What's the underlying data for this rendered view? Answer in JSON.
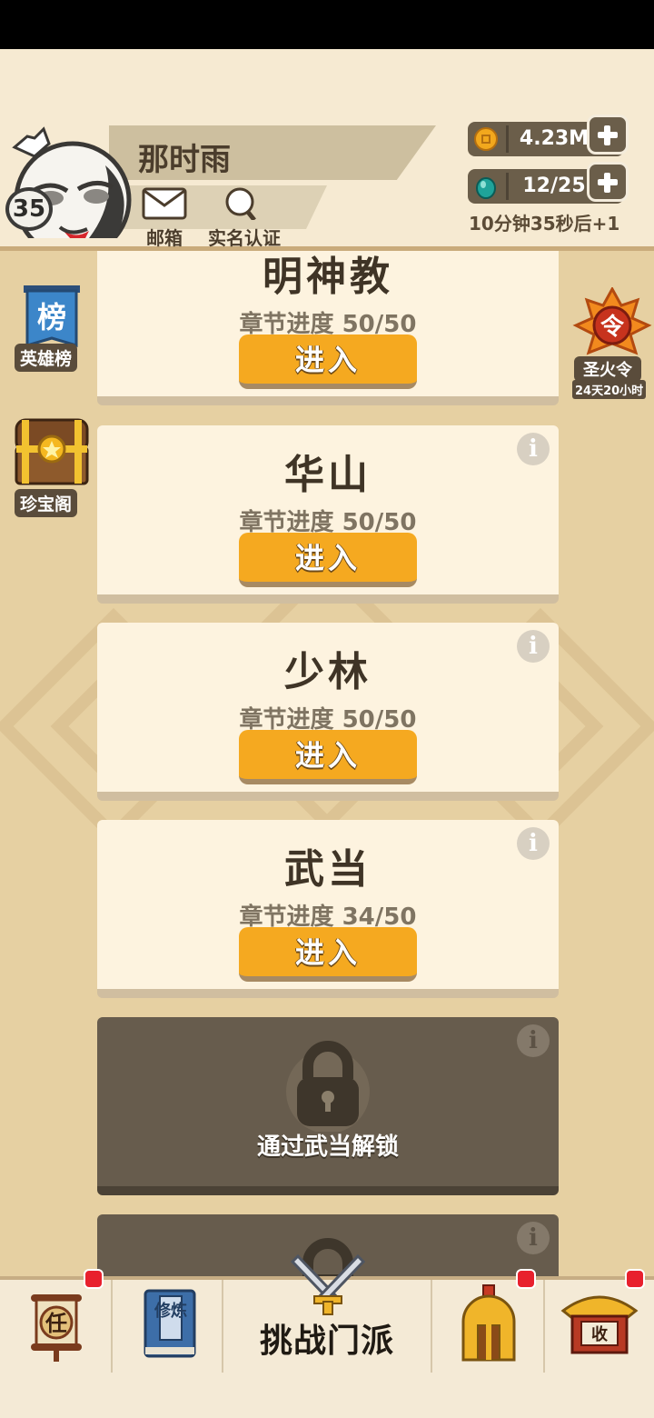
{
  "player": {
    "name": "那时雨",
    "level": "35",
    "mail_label": "邮箱",
    "verify_label": "实名认证"
  },
  "resources": {
    "coins": "4.23M",
    "energy": "12/25",
    "energy_timer": "10分钟35秒后+1"
  },
  "side": {
    "hero_rank": {
      "glyph": "榜",
      "label": "英雄榜"
    },
    "treasure": {
      "label": "珍宝阁"
    },
    "holy_fire": {
      "glyph": "令",
      "label": "圣火令",
      "time": "24天20小时"
    }
  },
  "sects": [
    {
      "title": "明神教",
      "progress": "章节进度 50/50",
      "button": "进入"
    },
    {
      "title": "华山",
      "progress": "章节进度 50/50",
      "button": "进入"
    },
    {
      "title": "少林",
      "progress": "章节进度 50/50",
      "button": "进入"
    },
    {
      "title": "武当",
      "progress": "章节进度 34/50",
      "button": "进入"
    }
  ],
  "locked": [
    {
      "text": "通过武当解锁"
    },
    {
      "text": ""
    }
  ],
  "info_glyph": "i",
  "nav": {
    "task_glyph": "任",
    "train_glyph": "修炼",
    "challenge_label": "挑战门派",
    "collect_glyph": "收"
  },
  "colors": {
    "accent": "#f5a920",
    "background": "#e6d0a2",
    "card": "#fdf3df",
    "locked_card": "#675c4d",
    "badge_red": "#e8202d"
  }
}
